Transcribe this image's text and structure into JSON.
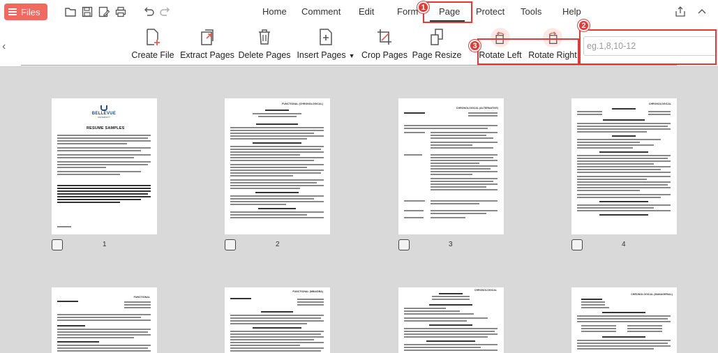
{
  "menubar": {
    "files_label": "Files",
    "menu": [
      "Home",
      "Comment",
      "Edit",
      "Form",
      "Page",
      "Protect",
      "Tools",
      "Help"
    ],
    "active": "Page"
  },
  "toolbar": {
    "tools": [
      {
        "label": "Create File",
        "icon": "create-file-icon"
      },
      {
        "label": "Extract Pages",
        "icon": "extract-pages-icon"
      },
      {
        "label": "Delete Pages",
        "icon": "trash-icon"
      },
      {
        "label": "Insert Pages",
        "icon": "insert-pages-icon"
      },
      {
        "label": "Crop Pages",
        "icon": "crop-icon"
      },
      {
        "label": "Page Resize",
        "icon": "page-resize-icon"
      },
      {
        "label": "Rotate Left",
        "icon": "rotate-left-icon"
      },
      {
        "label": "Rotate Right",
        "icon": "rotate-right-icon"
      }
    ],
    "page_range_placeholder": "eg.1,8,10-12"
  },
  "annotations": {
    "badges": [
      "1",
      "2",
      "3"
    ],
    "color": "#e53935"
  },
  "thumbnails": {
    "pages": [
      {
        "number": "1",
        "heading": "BELLEVUE",
        "subtitle": "RESUME SAMPLES"
      },
      {
        "number": "2",
        "heading": "FUNCTIONAL (CHRONOLOGICAL)"
      },
      {
        "number": "3",
        "heading": "CHRONOLOGICAL (ALTERNATIVE)"
      },
      {
        "number": "4",
        "heading": "CHRONOLOGICAL"
      },
      {
        "number": "",
        "heading": "FUNCTIONAL"
      },
      {
        "number": "",
        "heading": "FUNCTIONAL (MBA/DBA)"
      },
      {
        "number": "",
        "heading": "CHRONOLOGICAL"
      },
      {
        "number": "",
        "heading": "CHRONOLOGICAL (MANAGERIAL)"
      }
    ]
  },
  "colors": {
    "files_button": "#f06a5f",
    "highlight": "#e53935",
    "workspace_bg": "#d9d9d9"
  }
}
